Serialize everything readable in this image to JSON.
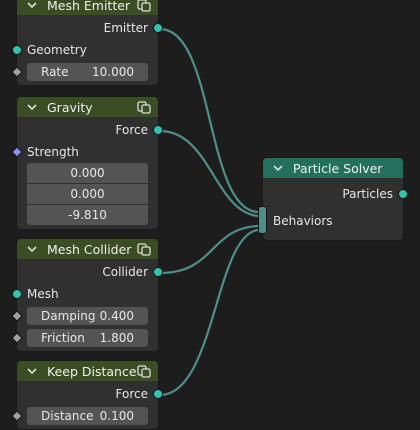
{
  "colors": {
    "socket_geometry": "#2fc3b0",
    "socket_vector": "#8c8cf2",
    "link": "#4f8f8a",
    "header_green": "#3b4d22",
    "header_teal": "#25705d"
  },
  "nodes": {
    "mesh_emitter": {
      "title": "Mesh Emitter",
      "output": "Emitter",
      "input": "Geometry",
      "rate_label": "Rate",
      "rate_value": "10.000"
    },
    "gravity": {
      "title": "Gravity",
      "output": "Force",
      "input": "Strength",
      "x": "0.000",
      "y": "0.000",
      "z": "-9.810"
    },
    "mesh_collider": {
      "title": "Mesh Collider",
      "output": "Collider",
      "input": "Mesh",
      "damping_label": "Damping",
      "damping_value": "0.400",
      "friction_label": "Friction",
      "friction_value": "1.800"
    },
    "keep_distance": {
      "title": "Keep Distance",
      "output": "Force",
      "distance_label": "Distance",
      "distance_value": "0.100"
    },
    "particle_solver": {
      "title": "Particle Solver",
      "output": "Particles",
      "input": "Behaviors"
    }
  },
  "icons": {
    "collapse": "chevron-down-icon",
    "node_group": "node-group-icon"
  }
}
